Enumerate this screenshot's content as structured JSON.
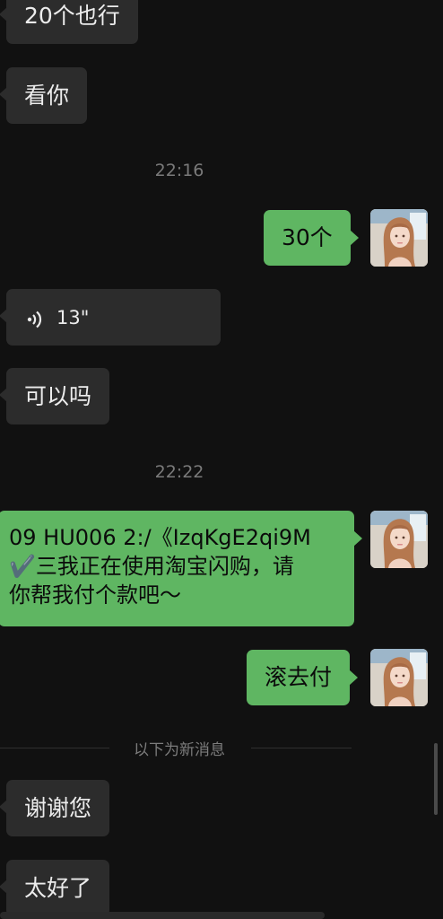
{
  "messages": {
    "m1": "20个也行",
    "m2": "看你",
    "t1": "22:16",
    "m3": "30个",
    "voice_duration": "13\"",
    "m4": "可以吗",
    "t2": "22:22",
    "m5_line1": "09 HU006 2:/《IzqKgE2qi9M",
    "m5_line2": "✔️三我正在使用淘宝闪购，请",
    "m5_line3": "你帮我付个款吧～",
    "m6": "滚去付",
    "divider_label": "以下为新消息",
    "m7": "谢谢您",
    "m8": "太好了"
  },
  "colors": {
    "background": "#111111",
    "incoming_bubble": "#2c2c2c",
    "outgoing_bubble": "#5fb662"
  },
  "icons": {
    "voice": "voice-wave-icon",
    "avatar": "user-avatar-icon"
  }
}
